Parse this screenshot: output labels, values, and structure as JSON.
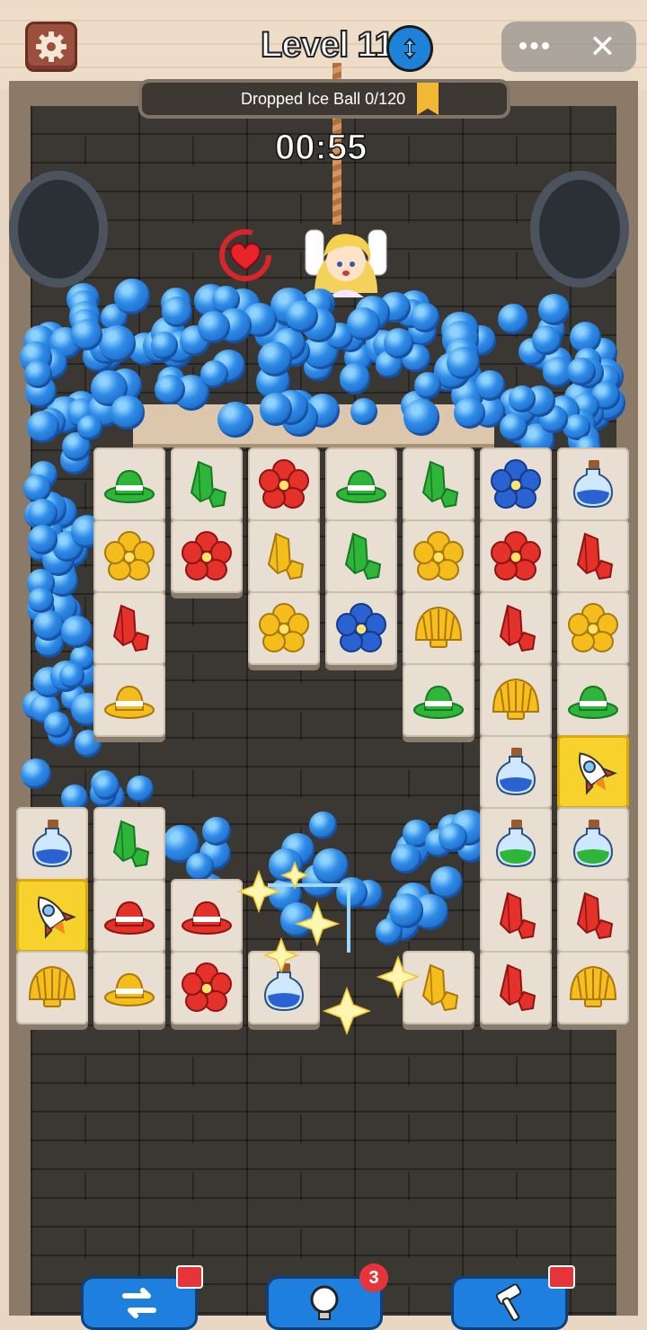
{
  "header": {
    "level_label": "Level 11",
    "goal_text": "Dropped Ice Ball  0/120",
    "timer": "00:55"
  },
  "icons": {
    "settings": "gear-icon",
    "level_info": "up-down-arrows-icon",
    "menu": "more-dots-icon",
    "close": "close-icon",
    "lives": "heart-icon"
  },
  "mini_menu": {
    "more_label": "•••",
    "close_label": "✕"
  },
  "board": {
    "rows": [
      [
        "green-hat",
        "green-gem",
        "red-flower",
        "green-hat",
        "green-gem",
        "blue-flower",
        "blue-potion"
      ],
      [
        "yellow-flower",
        "red-flower",
        "yellow-gem",
        "green-gem",
        "yellow-flower",
        "red-flower",
        "red-gem"
      ],
      [
        "red-gem",
        "",
        "yellow-flower",
        "blue-flower",
        "shell",
        "red-gem",
        "yellow-flower"
      ],
      [
        "yellow-hat",
        "",
        "",
        "",
        "green-hat",
        "shell",
        "green-hat"
      ],
      [
        "",
        "",
        "",
        "",
        "",
        "blue-potion",
        "rocket"
      ],
      [
        "blue-potion",
        "green-gem",
        "",
        "",
        "",
        "green-potion",
        "green-potion"
      ],
      [
        "rocket",
        "red-hat",
        "red-hat",
        "",
        "",
        "red-gem",
        "red-gem"
      ],
      [
        "shell",
        "yellow-hat",
        "red-flower",
        "blue-potion",
        "yellow-gem",
        "red-gem",
        "shell"
      ]
    ]
  },
  "boosters": {
    "hint_count": "3",
    "items": [
      "shuffle-icon",
      "hint-bulb-icon",
      "hammer-icon"
    ]
  },
  "colors": {
    "ice_ball": "#2e8be6",
    "tile": "#e8dfd2",
    "special_tile": "#f8d22c",
    "booster_button": "#1e7fde"
  }
}
